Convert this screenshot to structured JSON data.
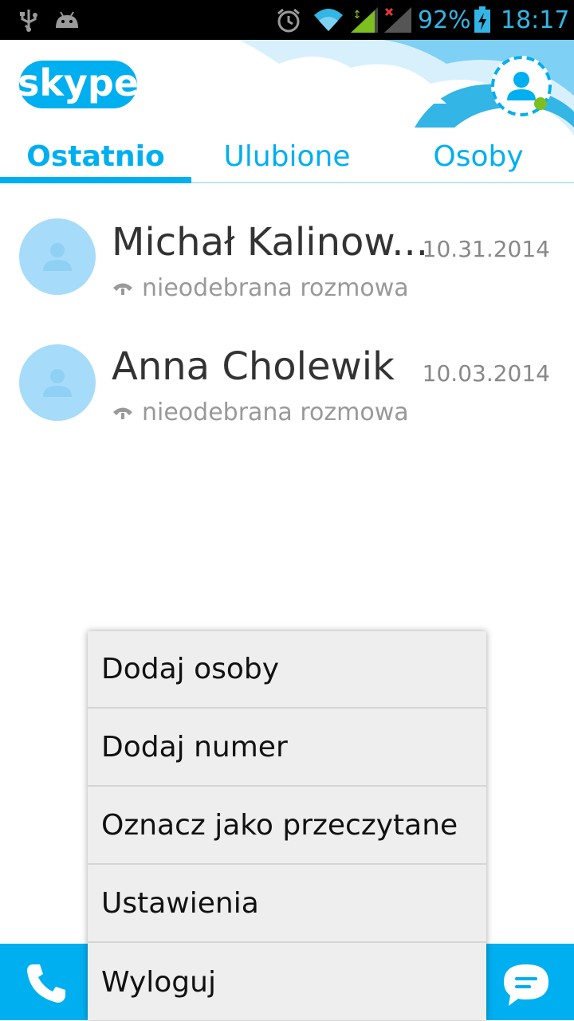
{
  "status_bar": {
    "battery_percent": "92%",
    "time": "18:17",
    "icons": [
      "usb-icon",
      "android-icon",
      "alarm-icon",
      "wifi-icon",
      "signal-icon",
      "signal-no-data-icon",
      "battery-charging-icon"
    ]
  },
  "header": {
    "logo_text": "skype",
    "tabs": [
      {
        "label": "Ostatnio",
        "active": true
      },
      {
        "label": "Ulubione",
        "active": false
      },
      {
        "label": "Osoby",
        "active": false
      }
    ],
    "accent_color": "#00aff0",
    "presence_color": "#7cbf1e"
  },
  "recent": [
    {
      "name": "Michał Kalinow...",
      "date": "10.31.2014",
      "status": "nieodebrana rozmowa"
    },
    {
      "name": "Anna Cholewik",
      "date": "10.03.2014",
      "status": "nieodebrana rozmowa"
    }
  ],
  "menu": {
    "items": [
      {
        "label": "Dodaj osoby"
      },
      {
        "label": "Dodaj numer"
      },
      {
        "label": "Oznacz jako przeczytane"
      },
      {
        "label": "Ustawienia"
      },
      {
        "label": "Wyloguj"
      }
    ]
  },
  "bottom_bar": {
    "icons": [
      "phone-icon",
      "chat-icon"
    ]
  }
}
